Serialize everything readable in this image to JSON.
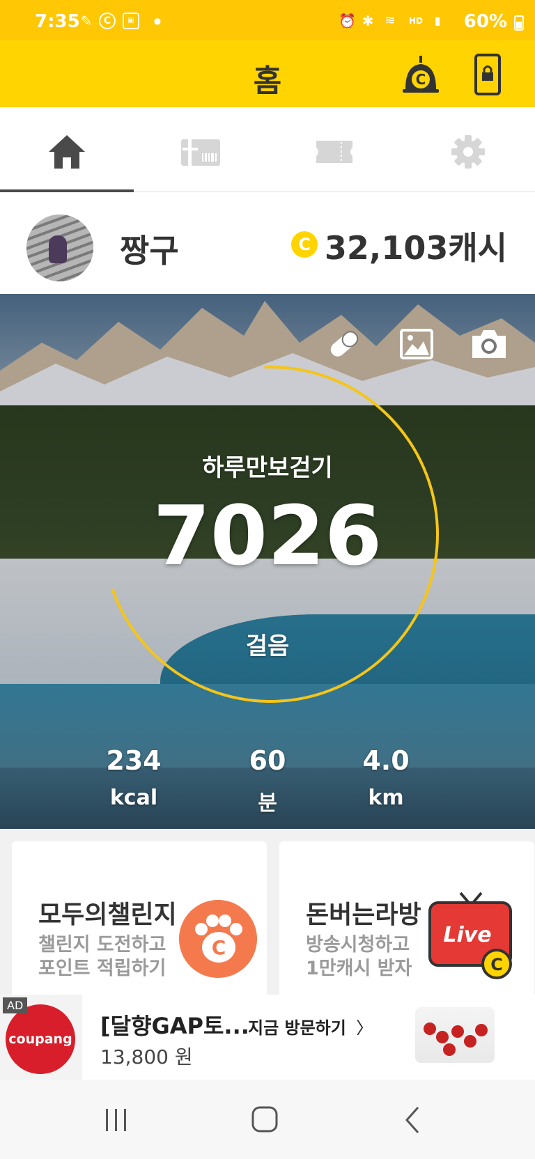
{
  "status_bar": {
    "time": "7:35",
    "battery": "60%",
    "icons": [
      "signature-icon",
      "c-coin-icon",
      "app-notification-icon",
      "dot-icon",
      "alarm-icon",
      "bluetooth-icon",
      "wifi-icon",
      "hd-voice-icon",
      "signal-icon",
      "battery-icon"
    ]
  },
  "header": {
    "title": "홈",
    "icons": [
      "cash-bell-icon",
      "lock-screen-icon"
    ]
  },
  "tabs": [
    {
      "name": "home",
      "icon": "home-icon",
      "active": true
    },
    {
      "name": "gift",
      "icon": "gift-card-icon",
      "active": false
    },
    {
      "name": "ticket",
      "icon": "ticket-icon",
      "active": false
    },
    {
      "name": "settings",
      "icon": "gear-icon",
      "active": false
    }
  ],
  "profile": {
    "name": "짱구",
    "cash": "32,103캐시",
    "coin_letter": "C"
  },
  "hero": {
    "top_label": "하루만보걷기",
    "steps": "7026",
    "bottom_label": "걸음",
    "progress_fraction": 0.7026,
    "icons": [
      "pill-icon",
      "image-icon",
      "camera-icon"
    ],
    "stats": [
      {
        "value": "234",
        "unit": "kcal"
      },
      {
        "value": "60",
        "unit": "분"
      },
      {
        "value": "4.0",
        "unit": "km"
      }
    ]
  },
  "cards": [
    {
      "title": "모두의챌린지",
      "line1": "챌린지 도전하고",
      "line2": "포인트 적립하기",
      "icon": "paw-coin-icon"
    },
    {
      "title": "돈버는라방",
      "line1": "방송시청하고",
      "line2": "1만캐시 받자",
      "icon": "live-tv-icon",
      "badge": "Live"
    }
  ],
  "ad": {
    "tag": "AD",
    "brand": "coupang",
    "title": "[달향GAP토...",
    "price": "13,800 원",
    "cta": "지금 방문하기"
  },
  "navbar": {
    "icons": [
      "recent-apps-icon",
      "home-nav-icon",
      "back-icon"
    ]
  },
  "colors": {
    "brand_yellow": "#FFD400",
    "status_yellow": "#FFC704",
    "progress_ring": "#F5C518",
    "paw_orange": "#F47A4E",
    "live_red": "#E53935"
  }
}
